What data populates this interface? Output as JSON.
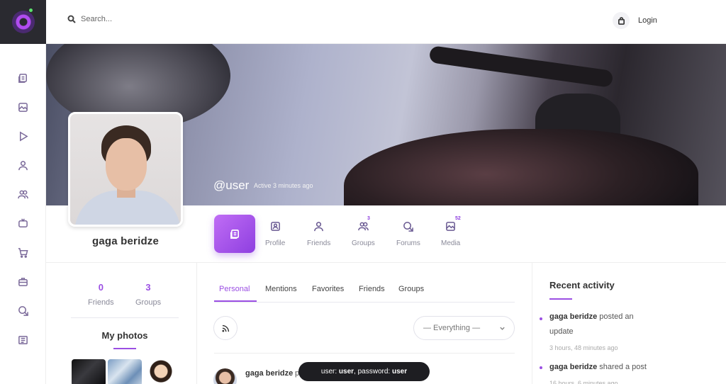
{
  "search": {
    "placeholder": "Search..."
  },
  "header": {
    "login": "Login"
  },
  "cover": {
    "username": "@user",
    "active": "Active 3 minutes ago"
  },
  "profile": {
    "name": "gaga beridze"
  },
  "nav": {
    "items": [
      {
        "label": "Profile",
        "badge": ""
      },
      {
        "label": "Friends",
        "badge": ""
      },
      {
        "label": "Groups",
        "badge": "3"
      },
      {
        "label": "Forums",
        "badge": ""
      },
      {
        "label": "Media",
        "badge": "52"
      }
    ]
  },
  "stats": {
    "friends": {
      "value": "0",
      "label": "Friends"
    },
    "groups": {
      "value": "3",
      "label": "Groups"
    }
  },
  "photos": {
    "title": "My photos"
  },
  "tabs": [
    "Personal",
    "Mentions",
    "Favorites",
    "Friends",
    "Groups"
  ],
  "filter": {
    "value": "— Everything —"
  },
  "post": {
    "author": "gaga beridze",
    "rest": "p"
  },
  "toast": {
    "user_label": "user:",
    "user": "user",
    "pass_label": ", password:",
    "pass": "user"
  },
  "activity": {
    "title": "Recent activity",
    "items": [
      {
        "author": "gaga beridze",
        "text": " posted an update",
        "time": "3 hours, 48 minutes ago"
      },
      {
        "author": "gaga beridze",
        "text": " shared a post",
        "time": "16 hours, 6 minutes ago"
      }
    ]
  },
  "colors": {
    "accent": "#9b4fe3",
    "rail_logo_bg": "#2a2a30",
    "toast_bg": "#1e1e22"
  }
}
